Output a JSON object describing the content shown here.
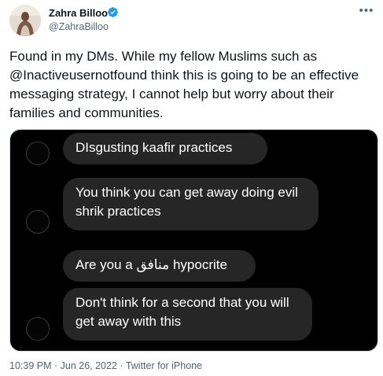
{
  "author": {
    "display_name": "Zahra Billoo",
    "handle": "@ZahraBilloo",
    "verified_icon": "verified-badge-icon",
    "avatar_icon": "profile-photo"
  },
  "more_label": "•••",
  "tweet_text": "Found in my DMs. While my fellow Muslims such as @Inactiveusernotfound think this is going to be an effective messaging strategy, I cannot help but worry about their families and communities.",
  "media": {
    "messages": [
      "DIsgusting kaafir practices",
      "You think you can get away doing evil shrik practices",
      "Are you a منافق hypocrite",
      "Don't think for a second that you will get away with this"
    ]
  },
  "meta": {
    "time": "10:39 PM",
    "date": "Jun 26, 2022",
    "source": "Twitter for iPhone"
  },
  "colors": {
    "verified": "#1d9bf0",
    "bubble": "#262626",
    "secondary_text": "#536471"
  }
}
